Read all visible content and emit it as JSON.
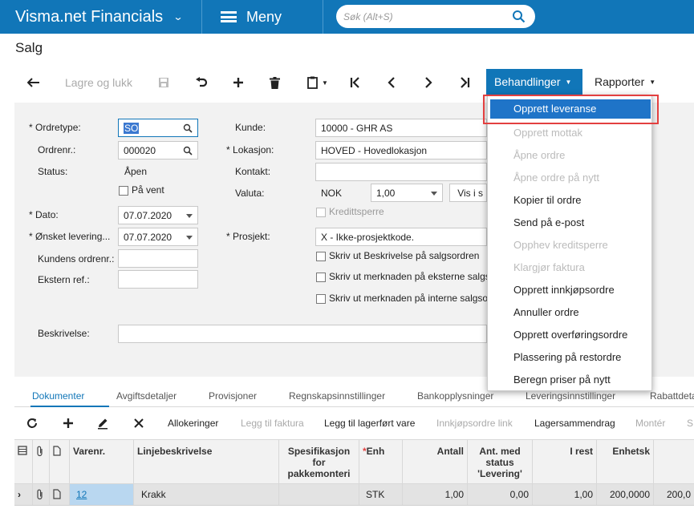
{
  "app": {
    "title": "Visma.net Financials",
    "menu": "Meny",
    "search_placeholder": "Søk (Alt+S)"
  },
  "page": {
    "title": "Salg"
  },
  "toolbar": {
    "save_close": "Lagre og lukk",
    "actions": "Behandlinger",
    "reports": "Rapporter"
  },
  "form": {
    "ordertype_label": "Ordretype:",
    "ordertype": "SO",
    "ordernr_label": "Ordrenr.:",
    "ordernr": "000020",
    "status_label": "Status:",
    "status": "Åpen",
    "onhold_label": "På vent",
    "date_label": "Dato:",
    "date": "07.07.2020",
    "wished_label": "Ønsket levering...",
    "wished": "07.07.2020",
    "custorder_label": "Kundens ordrenr.:",
    "extref_label": "Ekstern ref.:",
    "desc_label": "Beskrivelse:",
    "customer_label": "Kunde:",
    "customer": "10000 - GHR AS",
    "location_label": "Lokasjon:",
    "location": "HOVED - Hovedlokasjon",
    "contact_label": "Kontakt:",
    "currency_label": "Valuta:",
    "currency": "NOK",
    "rate": "1,00",
    "vis": "Vis i s",
    "credit_label": "Kredittsperre",
    "project_label": "Prosjekt:",
    "project": "X - Ikke-prosjektkode.",
    "cb1": "Skriv ut Beskrivelse på salgsordren",
    "cb2": "Skriv ut merknaden på eksterne salgs",
    "cb3": "Skriv ut merknaden på interne salgso"
  },
  "tabs": [
    "Dokumenter",
    "Avgiftsdetaljer",
    "Provisjoner",
    "Regnskapsinnstillinger",
    "Bankopplysninger",
    "Leveringsinnstillinger",
    "Rabattdeta"
  ],
  "grid_toolbar": {
    "alloc": "Allokeringer",
    "add_invoice": "Legg til faktura",
    "add_stock": "Legg til lagerført vare",
    "po_link": "Innkjøpsordre link",
    "stock_summary": "Lagersammendrag",
    "mount": "Montér",
    "s": "S"
  },
  "grid": {
    "headers": {
      "item": "Varenr.",
      "desc": "Linjebeskrivelse",
      "spec": "Spesifikasjon for pakkemonteri",
      "unit": "Enh",
      "qty": "Antall",
      "qty_status": "Ant. med status 'Levering'",
      "rest": "I rest",
      "price": "Enhetsk"
    },
    "row": {
      "item": "12",
      "desc": "Krakk",
      "unit": "STK",
      "qty": "1,00",
      "qty_status": "0,00",
      "rest": "1,00",
      "price": "200,0000",
      "ext": "200,0"
    }
  },
  "menu_items": [
    "Opprett leveranse",
    "Opprett mottak",
    "Åpne ordre",
    "Åpne ordre på nytt",
    "Kopier til ordre",
    "Send på e-post",
    "Opphev kreditsperre",
    "Klargjør faktura",
    "Opprett innkjøpsordre",
    "Annuller ordre",
    "Opprett overføringsordre",
    "Plassering på restordre",
    "Beregn priser på nytt"
  ],
  "colors": {
    "brand": "#1176b8",
    "highlight": "#1f74c8",
    "callout": "#e34040"
  }
}
